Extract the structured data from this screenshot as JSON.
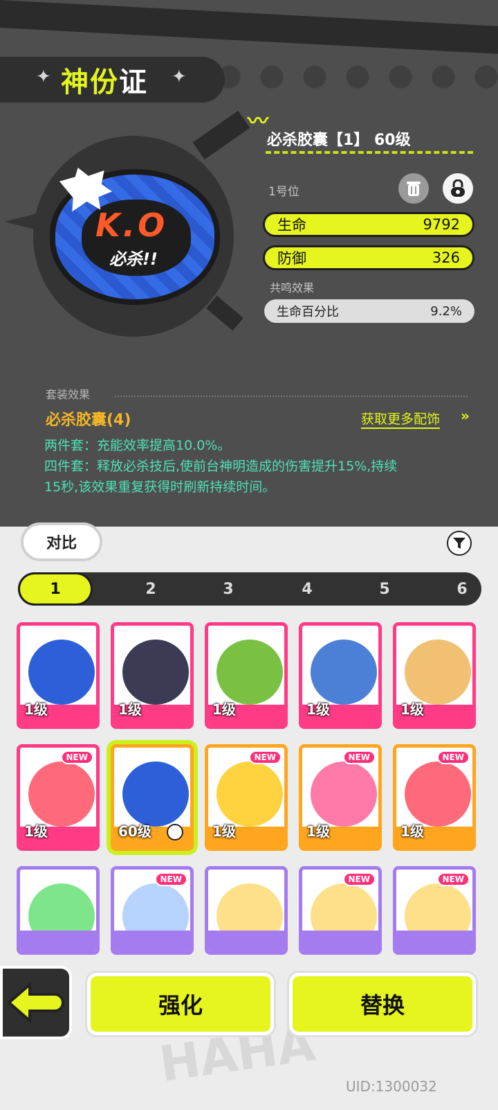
{
  "header": {
    "title_part1": "神份",
    "title_part2": "证"
  },
  "item": {
    "name": "必杀胶囊【1】 60级",
    "slot": "1号位",
    "stats": [
      {
        "label": "生命",
        "value": "9792"
      },
      {
        "label": "防御",
        "value": "326"
      }
    ],
    "resonance_label": "共鸣效果",
    "resonance": {
      "label": "生命百分比",
      "value": "9.2%"
    }
  },
  "set": {
    "label": "套装效果",
    "name": "必杀胶囊(4)",
    "more_link": "获取更多配饰",
    "effect_line1": "两件套：充能效率提高10.0%。",
    "effect_line2": "四件套：释放必杀技后,使前台神明造成的伤害提升15%,持续",
    "effect_line3": "15秒,该效果重复获得时刷新持续时间。"
  },
  "badge_art": {
    "ko": "K.O",
    "bisha": "必杀!!"
  },
  "compare_label": "对比",
  "tabs": [
    "1",
    "2",
    "3",
    "4",
    "5",
    "6"
  ],
  "active_tab": "1",
  "grid": [
    {
      "level": "1级",
      "color": "pink",
      "art": "ko-capsule",
      "new": false
    },
    {
      "level": "1级",
      "color": "pink",
      "art": "anime-girl",
      "new": false
    },
    {
      "level": "1级",
      "color": "pink",
      "art": "kiwi",
      "new": false
    },
    {
      "level": "1级",
      "color": "pink",
      "art": "shark",
      "new": false
    },
    {
      "level": "1级",
      "color": "pink",
      "art": "corgi",
      "new": false
    },
    {
      "level": "1级",
      "color": "pink",
      "art": "strawberry-jam",
      "new": true
    },
    {
      "level": "60级",
      "color": "orange",
      "art": "ko-capsule",
      "new": false,
      "locked": true,
      "selected": true
    },
    {
      "level": "1级",
      "color": "orange",
      "art": "come-late",
      "new": true
    },
    {
      "level": "1级",
      "color": "orange",
      "art": "bee-girl",
      "new": true
    },
    {
      "level": "1级",
      "color": "orange",
      "art": "strawberry-jam",
      "new": true
    },
    {
      "level": "",
      "color": "purple",
      "art": "trash-box",
      "new": false
    },
    {
      "level": "",
      "color": "purple",
      "art": "headphones",
      "new": true
    },
    {
      "level": "",
      "color": "purple",
      "art": "chicken-leg",
      "new": false
    },
    {
      "level": "",
      "color": "purple",
      "art": "chicken-leg",
      "new": true
    },
    {
      "level": "",
      "color": "purple",
      "art": "chicken-leg",
      "new": true
    }
  ],
  "card_text": {
    "new": "NEW"
  },
  "actions": {
    "enhance": "强化",
    "replace": "替换",
    "back": "BACK"
  },
  "uid": "UID:1300032",
  "colors": {
    "accent": "#e6f51e",
    "pink": "#ff3b86",
    "orange": "#ffa61e",
    "purple": "#a47cf0",
    "teal": "#4fe0b6",
    "gold": "#f5b628"
  }
}
